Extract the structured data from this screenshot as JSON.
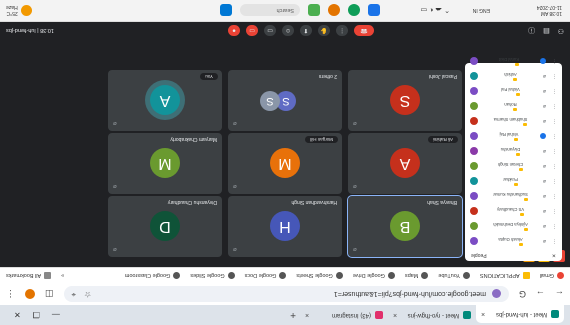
{
  "browser_tabs": [
    {
      "label": "Meet - luh-fwnd-jbs",
      "active": true,
      "close": "×"
    },
    {
      "label": "Meet - ryo-fhgw-jns",
      "active": false,
      "close": "×"
    },
    {
      "label": "(43) Instagram",
      "active": false,
      "close": "×"
    }
  ],
  "new_tab": "+",
  "window_controls": [
    "—",
    "❐",
    "✕"
  ],
  "address": {
    "url": "meet.google.com/luh-fwnd-jbs?pli=1&authuser=1",
    "back": "←",
    "forward": "→",
    "reload": "G"
  },
  "bookmarks": [
    "Gmail",
    "APPLICATIONS",
    "YouTube",
    "Maps",
    "Google Drive",
    "Google Sheets",
    "Google Docs",
    "Google Slides",
    "Google Classroom"
  ],
  "bookmarks_more": "»",
  "all_bookmarks": "All Bookmarks",
  "meeting": {
    "code": "luh-fwnd-jbs",
    "time": "10:38",
    "tiles": [
      {
        "label": "You",
        "initial": "A",
        "color": "#12939a",
        "name": "You"
      },
      {
        "label": "",
        "initial": "S",
        "color": "#5f6bc4",
        "second_initial": "S",
        "second_color": "#8a96a8",
        "name": "2 others"
      },
      {
        "label": "Pascal Joshi",
        "initial": "S",
        "color": "#c5301c",
        "name": "Pascal Joshi"
      },
      {
        "label": "Maryam Chakraborty",
        "initial": "M",
        "color": "#6a9a2f",
        "name": "Maryam Chakraborty"
      },
      {
        "label": "Morgan Hill",
        "initial": "M",
        "color": "#e8710a",
        "name": "Morgan Hill"
      },
      {
        "label": "Ali Rahimi",
        "initial": "A",
        "color": "#c5301c",
        "name": "Ali Rahimi"
      },
      {
        "label": "Divyanshu Chaudhary",
        "initial": "D",
        "color": "#0f5338",
        "name": "Divyanshu Chaudhary"
      },
      {
        "label": "Harshvardhan Singh",
        "initial": "H",
        "color": "#4657b8",
        "name": "Harshvardhan Singh"
      },
      {
        "label": "Bhavya Shah",
        "initial": "B",
        "color": "#6a9a2f",
        "name": "Bhavya Shah"
      }
    ]
  },
  "participants_panel": {
    "title": "People",
    "close": "✕",
    "rows": [
      {
        "name": "Akash Gupta",
        "color": "#7b4dc4",
        "blue": false
      },
      {
        "name": "Ajinkya Deshmukh",
        "color": "#6a9a2f",
        "blue": false
      },
      {
        "name": "VS Chaudhary",
        "color": "#c5301c",
        "blue": false
      },
      {
        "name": "Sudhanshu Kumar",
        "color": "#7b4dc4",
        "blue": false
      },
      {
        "name": "Prakhar",
        "color": "#12939a",
        "blue": false
      },
      {
        "name": "Chetan Singh",
        "color": "#6a9a2f",
        "blue": false
      },
      {
        "name": "Divyanshu",
        "color": "#8a3aa8",
        "blue": false
      },
      {
        "name": "Vishal Raj",
        "color": "#7b4dc4",
        "blue": true
      },
      {
        "name": "Shubham Sharma",
        "color": "#c5301c",
        "blue": false
      },
      {
        "name": "Rohan",
        "color": "#6a9a2f",
        "blue": false
      },
      {
        "name": "Vishal Pal",
        "color": "#7b4dc4",
        "blue": false
      },
      {
        "name": "Ashish",
        "color": "#12939a",
        "blue": false
      },
      {
        "name": "Kunal Dixit",
        "color": "#7b4dc4",
        "blue": true
      }
    ]
  },
  "taskbar": {
    "weather_temp": "25°C",
    "weather_desc": "Haze",
    "search_placeholder": "Search",
    "time": "10:38 AM",
    "date": "11-07-2024",
    "lang": "ENG IN"
  }
}
